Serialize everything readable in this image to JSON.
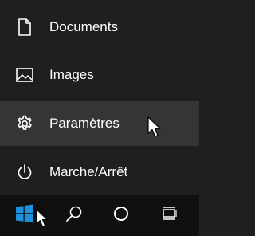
{
  "start_menu": {
    "items": [
      {
        "label": "Documents",
        "icon": "document-icon"
      },
      {
        "label": "Images",
        "icon": "image-icon"
      },
      {
        "label": "Paramètres",
        "icon": "gear-icon",
        "hovered": true
      },
      {
        "label": "Marche/Arrêt",
        "icon": "power-icon"
      }
    ]
  },
  "taskbar": {
    "buttons": [
      {
        "icon": "windows-start-icon"
      },
      {
        "icon": "search-icon"
      },
      {
        "icon": "cortana-icon"
      },
      {
        "icon": "task-view-icon"
      }
    ]
  },
  "colors": {
    "menu_bg": "#1f1f1f",
    "hover_bg": "#353535",
    "taskbar_bg": "#101010",
    "windows_blue": "#1e90e0"
  }
}
